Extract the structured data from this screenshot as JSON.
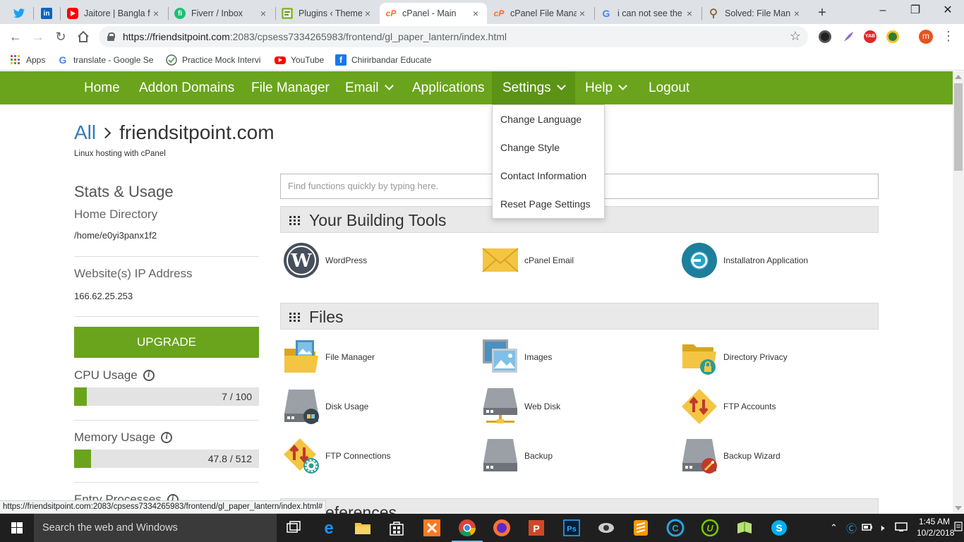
{
  "browser": {
    "tabs": [
      {
        "label": "",
        "icon": "twitter-icon"
      },
      {
        "label": "",
        "icon": "linkedin-icon"
      },
      {
        "label": "Jaitore | Bangla f",
        "icon": "youtube-icon"
      },
      {
        "label": "Fiverr / Inbox",
        "icon": "fiverr-icon"
      },
      {
        "label": "Plugins ‹ Theme",
        "icon": "wordpress-plugin-icon"
      },
      {
        "label": "cPanel - Main",
        "icon": "cpanel-icon"
      },
      {
        "label": "cPanel File Mana",
        "icon": "cpanel-icon"
      },
      {
        "label": "i can not see the",
        "icon": "google-icon"
      },
      {
        "label": "Solved: File Man",
        "icon": "forum-icon"
      }
    ],
    "url": "https://friendsitpoint.com:2083/cpsess7334265983/frontend/gl_paper_lantern/index.html",
    "url_host": "https://friendsitpoint.com",
    "url_rest": ":2083/cpsess7334265983/frontend/gl_paper_lantern/index.html",
    "profile_letter": "m",
    "bookmarks": [
      {
        "label": "Apps"
      },
      {
        "label": "translate - Google Se"
      },
      {
        "label": "Practice Mock Intervi"
      },
      {
        "label": "YouTube"
      },
      {
        "label": "Chirirbandar Educate"
      }
    ],
    "status_url": "https://friendsitpoint.com:2083/cpsess7334265983/frontend/gl_paper_lantern/index.html#"
  },
  "nav": {
    "items": [
      {
        "label": "Home"
      },
      {
        "label": "Addon Domains"
      },
      {
        "label": "File Manager"
      },
      {
        "label": "Email"
      },
      {
        "label": "Applications"
      },
      {
        "label": "Settings"
      },
      {
        "label": "Help"
      },
      {
        "label": "Logout"
      }
    ],
    "settings_menu": [
      "Change Language",
      "Change Style",
      "Contact Information",
      "Reset Page Settings"
    ]
  },
  "page": {
    "breadcrumb_all": "All",
    "domain": "friendsitpoint.com",
    "subtitle": "Linux hosting with cPanel",
    "search_placeholder": "Find functions quickly by typing here."
  },
  "sidebar": {
    "stats_title": "Stats & Usage",
    "home_dir_label": "Home Directory",
    "home_dir_value": "/home/e0yi3panx1f2",
    "ip_label": "Website(s) IP Address",
    "ip_value": "166.62.25.253",
    "upgrade_label": "UPGRADE",
    "cpu_label": "CPU Usage",
    "cpu_value": "7 / 100",
    "cpu_fraction": 0.07,
    "memory_label": "Memory Usage",
    "memory_value": "47.8 / 512",
    "memory_fraction": 0.093,
    "entry_label": "Entry Processes"
  },
  "sections": {
    "building_tools": {
      "title": "Your Building Tools",
      "items": [
        "WordPress",
        "cPanel Email",
        "Installatron Application"
      ]
    },
    "files": {
      "title": "Files",
      "items": [
        "File Manager",
        "Images",
        "Directory Privacy",
        "Disk Usage",
        "Web Disk",
        "FTP Accounts",
        "FTP Connections",
        "Backup",
        "Backup Wizard"
      ]
    },
    "next_title": "Preferences"
  },
  "taskbar": {
    "search_placeholder": "Search the web and Windows",
    "time": "1:45 AM",
    "date": "10/2/2018"
  },
  "colors": {
    "cpanel_green": "#6aa41c",
    "chrome_tabstrip": "#dee1e6",
    "taskbar": "#1f1f1f"
  }
}
